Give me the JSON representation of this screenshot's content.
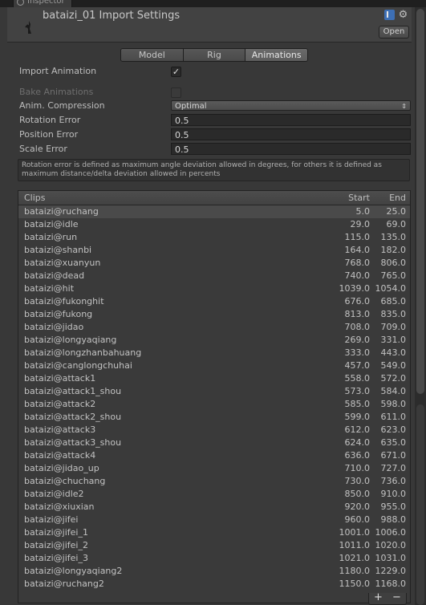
{
  "window": {
    "tab_label": "Inspector"
  },
  "header": {
    "title": "bataizi_01 Import Settings",
    "open_label": "Open"
  },
  "tabs": [
    {
      "label": "Model"
    },
    {
      "label": "Rig"
    },
    {
      "label": "Animations"
    }
  ],
  "settings": {
    "import_animation": {
      "label": "Import Animation",
      "checked": true
    },
    "bake_animations": {
      "label": "Bake Animations",
      "checked": false
    },
    "anim_compression": {
      "label": "Anim. Compression",
      "value": "Optimal"
    },
    "rotation_error": {
      "label": "Rotation Error",
      "value": "0.5"
    },
    "position_error": {
      "label": "Position Error",
      "value": "0.5"
    },
    "scale_error": {
      "label": "Scale Error",
      "value": "0.5"
    }
  },
  "help_text": "Rotation error is defined as maximum angle deviation allowed in degrees, for others it is defined as maximum distance/delta deviation allowed in percents",
  "clips": {
    "headers": {
      "name": "Clips",
      "start": "Start",
      "end": "End"
    },
    "rows": [
      {
        "name": "bataizi@ruchang",
        "start": "5.0",
        "end": "25.0"
      },
      {
        "name": "bataizi@idle",
        "start": "29.0",
        "end": "69.0"
      },
      {
        "name": "bataizi@run",
        "start": "115.0",
        "end": "135.0"
      },
      {
        "name": "bataizi@shanbi",
        "start": "164.0",
        "end": "182.0"
      },
      {
        "name": "bataizi@xuanyun",
        "start": "768.0",
        "end": "806.0"
      },
      {
        "name": "bataizi@dead",
        "start": "740.0",
        "end": "765.0"
      },
      {
        "name": "bataizi@hit",
        "start": "1039.0",
        "end": "1054.0"
      },
      {
        "name": "bataizi@fukonghit",
        "start": "676.0",
        "end": "685.0"
      },
      {
        "name": "bataizi@fukong",
        "start": "813.0",
        "end": "835.0"
      },
      {
        "name": "bataizi@jidao",
        "start": "708.0",
        "end": "709.0"
      },
      {
        "name": "bataizi@longyaqiang",
        "start": "269.0",
        "end": "331.0"
      },
      {
        "name": "bataizi@longzhanbahuang",
        "start": "333.0",
        "end": "443.0"
      },
      {
        "name": "bataizi@canglongchuhai",
        "start": "457.0",
        "end": "549.0"
      },
      {
        "name": "bataizi@attack1",
        "start": "558.0",
        "end": "572.0"
      },
      {
        "name": "bataizi@attack1_shou",
        "start": "573.0",
        "end": "584.0"
      },
      {
        "name": "bataizi@attack2",
        "start": "585.0",
        "end": "598.0"
      },
      {
        "name": "bataizi@attack2_shou",
        "start": "599.0",
        "end": "611.0"
      },
      {
        "name": "bataizi@attack3",
        "start": "612.0",
        "end": "623.0"
      },
      {
        "name": "bataizi@attack3_shou",
        "start": "624.0",
        "end": "635.0"
      },
      {
        "name": "bataizi@attack4",
        "start": "636.0",
        "end": "671.0"
      },
      {
        "name": "bataizi@jidao_up",
        "start": "710.0",
        "end": "727.0"
      },
      {
        "name": "bataizi@chuchang",
        "start": "730.0",
        "end": "736.0"
      },
      {
        "name": "bataizi@idle2",
        "start": "850.0",
        "end": "910.0"
      },
      {
        "name": "bataizi@xiuxian",
        "start": "920.0",
        "end": "955.0"
      },
      {
        "name": "bataizi@jifei",
        "start": "960.0",
        "end": "988.0"
      },
      {
        "name": "bataizi@jifei_1",
        "start": "1001.0",
        "end": "1006.0"
      },
      {
        "name": "bataizi@jifei_2",
        "start": "1011.0",
        "end": "1020.0"
      },
      {
        "name": "bataizi@jifei_3",
        "start": "1021.0",
        "end": "1031.0"
      },
      {
        "name": "bataizi@longyaqiang2",
        "start": "1180.0",
        "end": "1229.0"
      },
      {
        "name": "bataizi@ruchang2",
        "start": "1150.0",
        "end": "1168.0"
      }
    ],
    "add_label": "+",
    "remove_label": "−"
  },
  "icons": {
    "help": "book-icon",
    "settings": "gear-icon",
    "asset": "model-icon"
  },
  "colors": {
    "accent": "#3d6fb5",
    "panel_bg": "#383838"
  }
}
